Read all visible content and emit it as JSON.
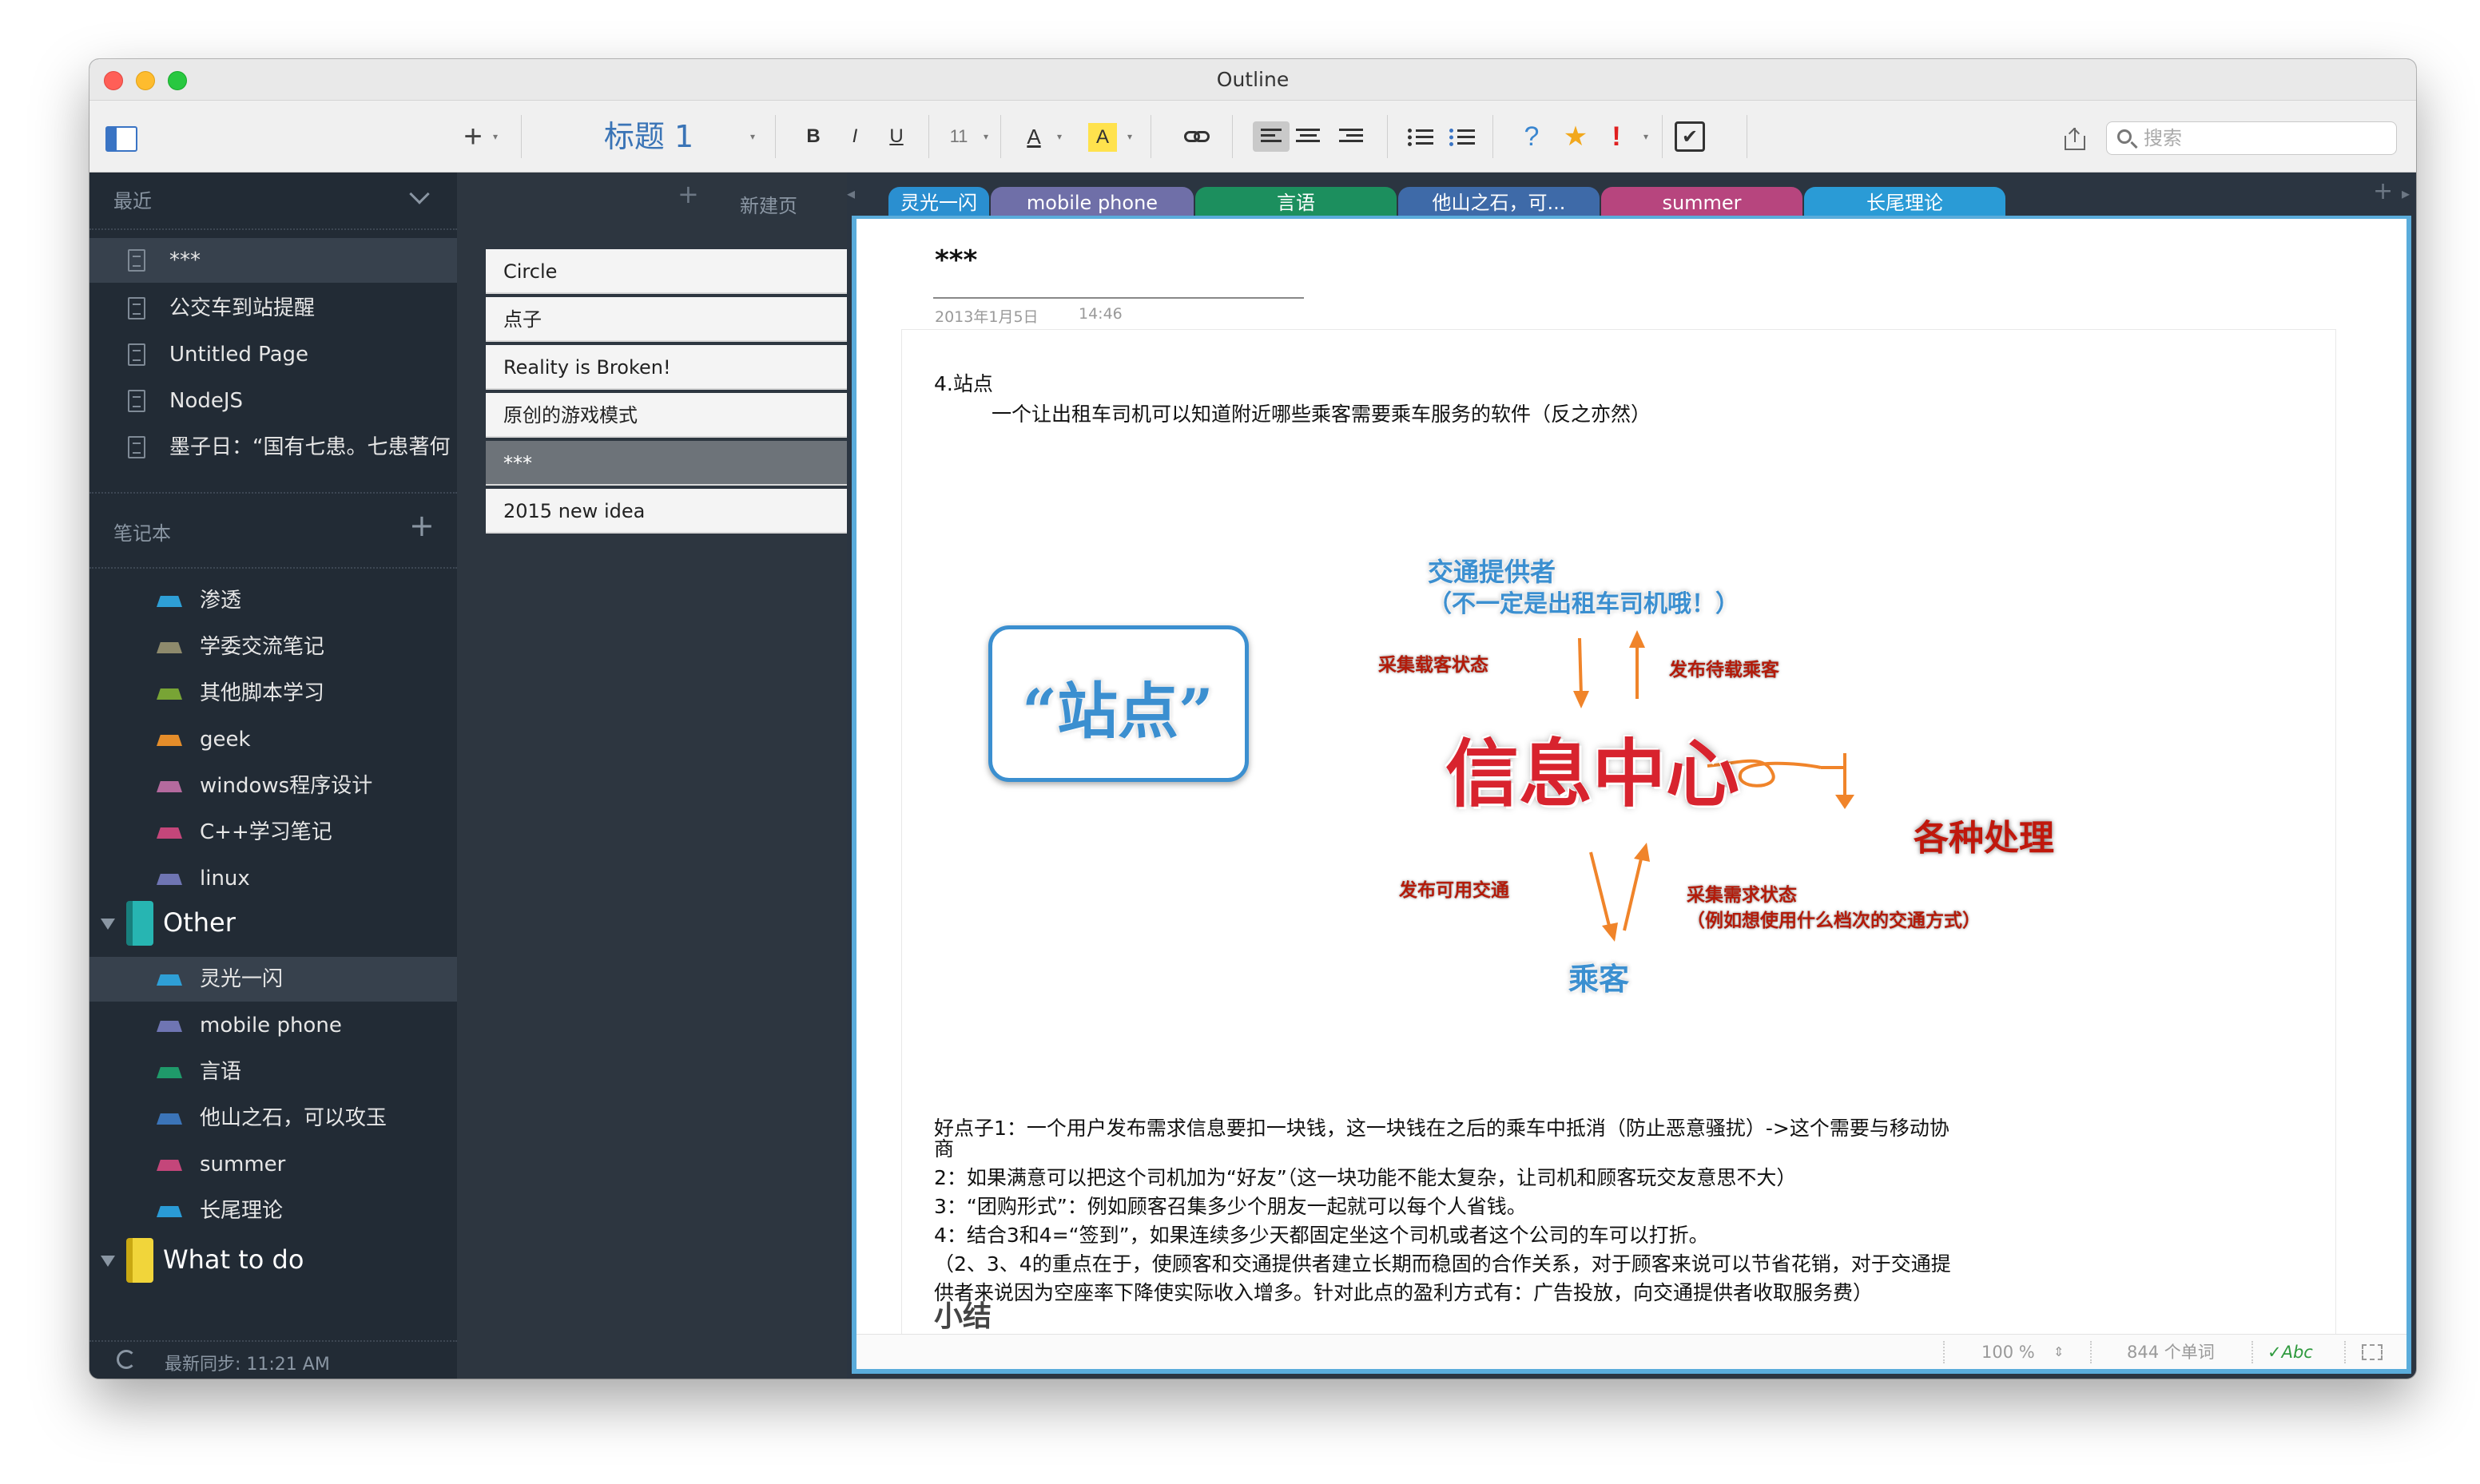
{
  "window": {
    "title": "Outline"
  },
  "toolbar": {
    "add": "+",
    "heading_style": "标题 1",
    "bold": "B",
    "italic": "I",
    "underline": "U",
    "font_size": "11",
    "font_color": "A",
    "highlight": "A",
    "question": "?",
    "star": "★",
    "exclaim": "!",
    "check": "✔",
    "search_placeholder": "搜索"
  },
  "sidebar": {
    "recent_label": "最近",
    "recent": [
      "***",
      "公交车到站提醒",
      "Untitled Page",
      "NodeJS",
      "墨子日：“国有七患。七患著何"
    ],
    "notebooks_label": "笔记本",
    "notebooks": [
      {
        "name": "渗透",
        "color": "#2e9fd6"
      },
      {
        "name": "学委交流笔记",
        "color": "#8e8a6c"
      },
      {
        "name": "其他脚本学习",
        "color": "#78a435"
      },
      {
        "name": "geek",
        "color": "#e58d2a"
      },
      {
        "name": "windows程序设计",
        "color": "#b46a9e"
      },
      {
        "name": "C++学习笔记",
        "color": "#c4467a"
      },
      {
        "name": "linux",
        "color": "#6f75b3"
      }
    ],
    "stack_other": "Other",
    "other_sections": [
      {
        "name": "灵光一闪",
        "color": "#2e9fd6"
      },
      {
        "name": "mobile phone",
        "color": "#6f75b3"
      },
      {
        "name": "言语",
        "color": "#1f9a6a"
      },
      {
        "name": "他山之石，可以攻玉",
        "color": "#3b74b8"
      },
      {
        "name": "summer",
        "color": "#c4467a"
      },
      {
        "name": "长尾理论",
        "color": "#2a9bd6"
      }
    ],
    "stack_todo": "What to do",
    "sync": "最新同步: 11:21 AM"
  },
  "pages": {
    "new_page": "新建页",
    "items": [
      "Circle",
      "点子",
      "Reality is Broken!",
      "原创的游戏模式",
      "***",
      "2015 new idea"
    ]
  },
  "tabs": [
    {
      "label": "灵光一闪",
      "color": "#2a8fd0"
    },
    {
      "label": "mobile phone",
      "color": "#6f6fa8"
    },
    {
      "label": "言语",
      "color": "#1c8f5e"
    },
    {
      "label": "他山之石，可...",
      "color": "#3e6aa8"
    },
    {
      "label": "summer",
      "color": "#b7457e"
    },
    {
      "label": "长尾理论",
      "color": "#2a9bd6"
    }
  ],
  "note": {
    "title": "***",
    "date": "2013年1月5日",
    "time": "14:46",
    "heading": "4.站点",
    "subline": "一个让出租车司机可以知道附近哪些乘客需要乘车服务的软件（反之亦然）",
    "diagram": {
      "station": "“站点”",
      "provider": "交通提供者",
      "provider_note": "（不一定是出租车司机哦！）",
      "collect_load": "采集载客状态",
      "publish_wait": "发布待载乘客",
      "center": "信息中心",
      "processing": "各种处理",
      "publish_transport": "发布可用交通",
      "collect_demand": "采集需求状态",
      "demand_note": "（例如想使用什么档次的交通方式）",
      "passenger": "乘客"
    },
    "para1": "好点子1：一个用户发布需求信息要扣一块钱，这一块钱在之后的乘车中抵消（防止恶意骚扰）->这个需要与移动协",
    "para1b": "商",
    "para2": "2：如果满意可以把这个司机加为“好友”（这一块功能不能太复杂，让司机和顾客玩交友意思不大）",
    "para3": "3：“团购形式”：例如顾客召集多少个朋友一起就可以每个人省钱。",
    "para4": "4：结合3和4=“签到”，如果连续多少天都固定坐这个司机或者这个公司的车可以打折。",
    "para5": "（2、3、4的重点在于，使顾客和交通提供者建立长期而稳固的合作关系，对于顾客来说可以节省花销，对于交通提",
    "para5b": "供者来说因为空座率下降使实际收入增多。针对此点的盈利方式有：广告投放，向交通提供者收取服务费）",
    "summary": "小结"
  },
  "status": {
    "zoom": "100 %",
    "words": "844 个单词",
    "spell": "✓Abc"
  }
}
